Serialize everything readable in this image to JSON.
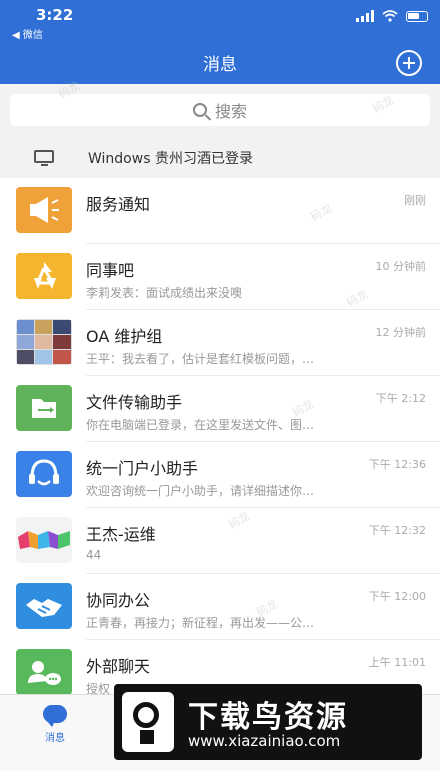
{
  "status_bar": {
    "time": "3:22",
    "back_label": "◀ 微信"
  },
  "nav": {
    "title": "消息"
  },
  "search": {
    "placeholder": "搜索"
  },
  "device_notice": {
    "text": "Windows 贵州习酒已登录"
  },
  "conversations": [
    {
      "name": "服务通知",
      "time": "刚刚",
      "preview": "",
      "icon": "megaphone-icon",
      "color": "#f0a23a"
    },
    {
      "name": "同事吧",
      "time": "10 分钟前",
      "preview": "李莉发表：面试成绩出来没噢",
      "icon": "network-icon",
      "color": "#f5b52e"
    },
    {
      "name": "OA 维护组",
      "time": "12 分钟前",
      "preview": "王平：我去看了，估计是套红模板问题，…",
      "icon": "group-collage-avatar",
      "color": "#5d7fbf"
    },
    {
      "name": "文件传输助手",
      "time": "下午 2:12",
      "preview": "你在电脑端已登录，在这里发送文件、图…",
      "icon": "folder-transfer-icon",
      "color": "#5fb25a"
    },
    {
      "name": "统一门户小助手",
      "time": "下午 12:36",
      "preview": "欢迎咨询统一门户小助手，请详细描述你…",
      "icon": "headset-icon",
      "color": "#3b82e8"
    },
    {
      "name": "王杰-运维",
      "time": "下午 12:32",
      "preview": "44",
      "icon": "colorful-avatar",
      "color": "#e65a8a"
    },
    {
      "name": "协同办公",
      "time": "下午 12:00",
      "preview": "正青春，再接力；新征程，再出发——公…",
      "icon": "handshake-icon",
      "color": "#2f8ee0"
    },
    {
      "name": "外部聊天",
      "time": "上午 11:01",
      "preview": "授权",
      "icon": "external-chat-icon",
      "color": "#58b85c"
    }
  ],
  "tabbar": {
    "messages_label": "消息"
  },
  "promo": {
    "brand": "下载鸟资源",
    "url": "www.xiazainiao.com"
  },
  "watermark": {
    "text": "码龙"
  }
}
